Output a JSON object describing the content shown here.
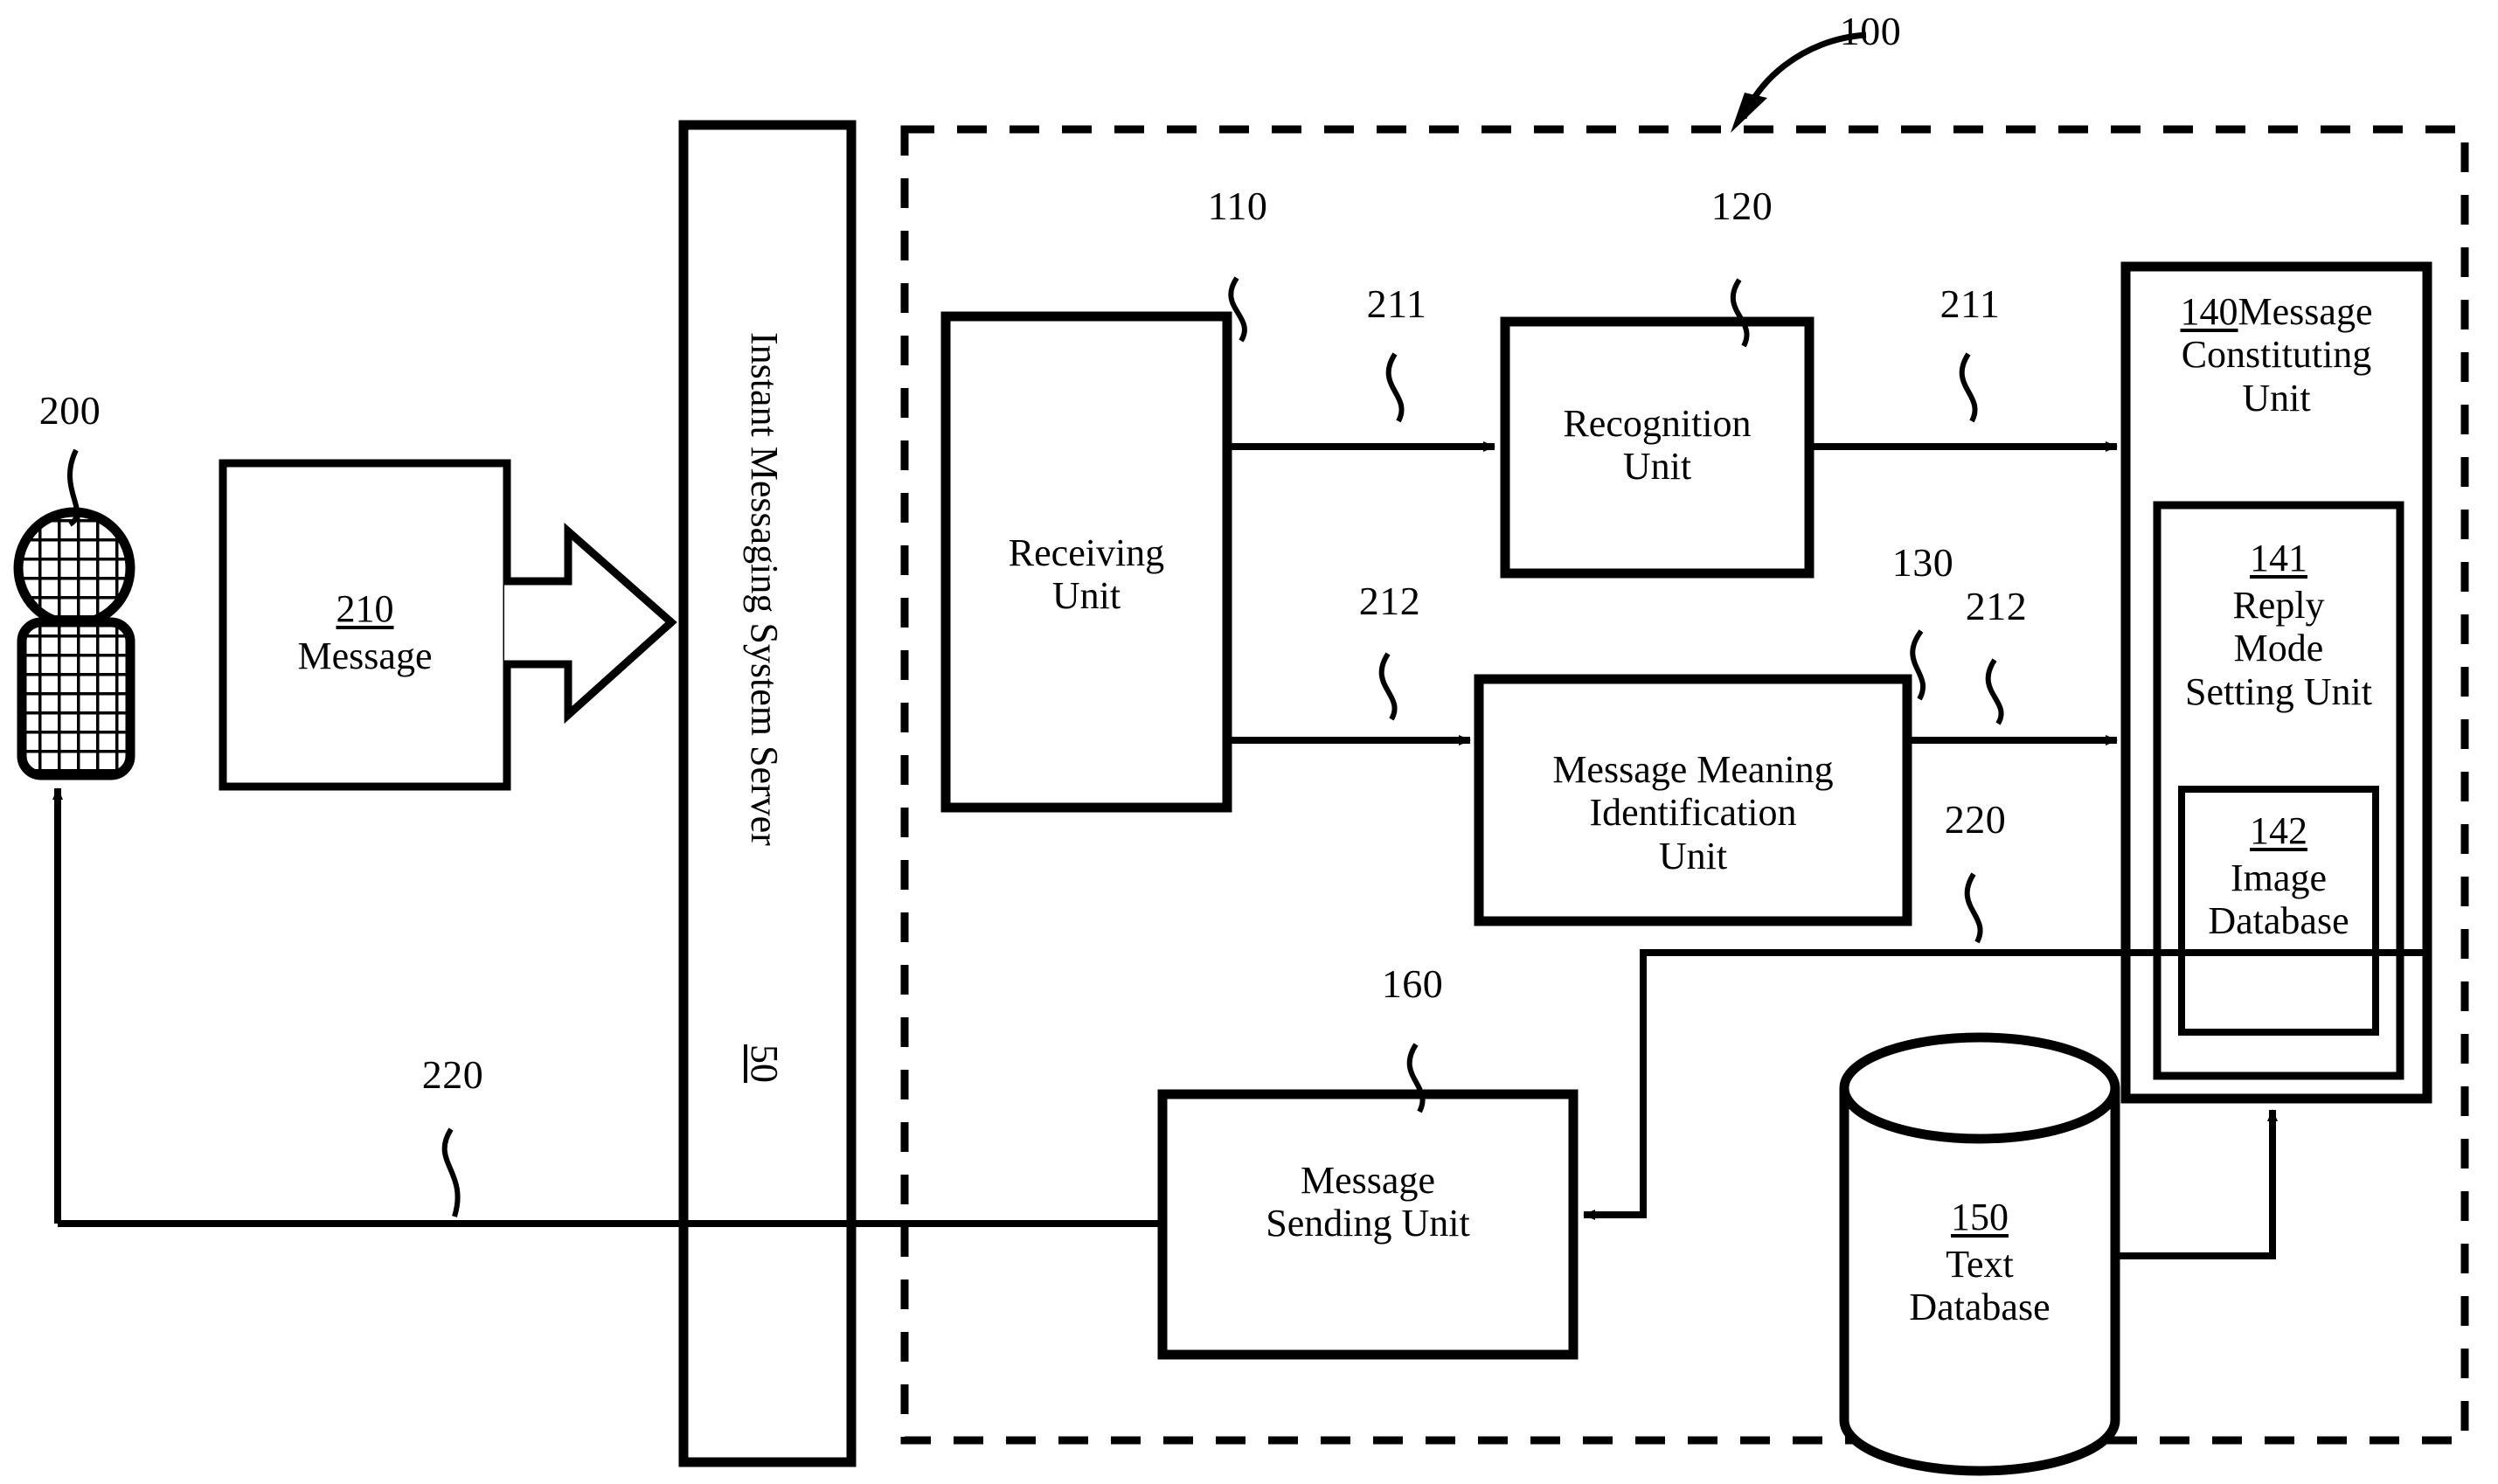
{
  "figure": {
    "title": "Instant messaging auto-reply system block diagram",
    "system_ref": "100",
    "user_ref": "200",
    "line_color": "#000000",
    "background": "#ffffff"
  },
  "actor": {
    "name": "user-figure",
    "ref": "200"
  },
  "message_box": {
    "ref": "210",
    "label": "Message"
  },
  "server": {
    "name": "Instant Messaging System Server",
    "ref": "50"
  },
  "blocks": {
    "receiving": {
      "ref": "110",
      "label": "Receiving\nUnit"
    },
    "recognition": {
      "ref": "120",
      "label": "Recognition\nUnit"
    },
    "meaning": {
      "ref": "130",
      "label": "Message Meaning\nIdentification\nUnit"
    },
    "constituting": {
      "ref": "140",
      "label": "Message\nConstituting\nUnit",
      "combined": "140Message"
    },
    "reply_mode": {
      "ref": "141",
      "label": "Reply\nMode\nSetting Unit"
    },
    "image_db": {
      "ref": "142",
      "label": "Image\nDatabase"
    },
    "text_db": {
      "ref": "150",
      "label": "Text\nDatabase"
    },
    "sending": {
      "ref": "160",
      "label": "Message\nSending Unit"
    }
  },
  "signals": {
    "s211_a": "211",
    "s211_b": "211",
    "s212_a": "212",
    "s212_b": "212",
    "s220_left": "220",
    "s220_right": "220"
  },
  "callouts": {
    "c100": "100",
    "c110": "110",
    "c120": "120",
    "c130": "130",
    "c160": "160",
    "c200": "200"
  }
}
